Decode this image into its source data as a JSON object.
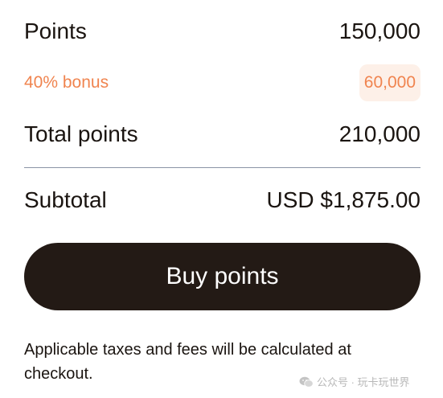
{
  "summary": {
    "points_label": "Points",
    "points_value": "150,000",
    "bonus_label": "40% bonus",
    "bonus_value": "60,000",
    "total_label": "Total points",
    "total_value": "210,000",
    "subtotal_label": "Subtotal",
    "subtotal_value": "USD $1,875.00"
  },
  "action": {
    "buy_label": "Buy points"
  },
  "disclaimer": "Applicable taxes and fees will be calculated at checkout.",
  "watermark": {
    "text": "公众号 · 玩卡玩世界",
    "icon": "wechat-icon"
  },
  "colors": {
    "bonus": "#f0844f",
    "bonus_bg": "#fdf0e8",
    "button_bg": "#231a15",
    "text": "#1a1410"
  }
}
